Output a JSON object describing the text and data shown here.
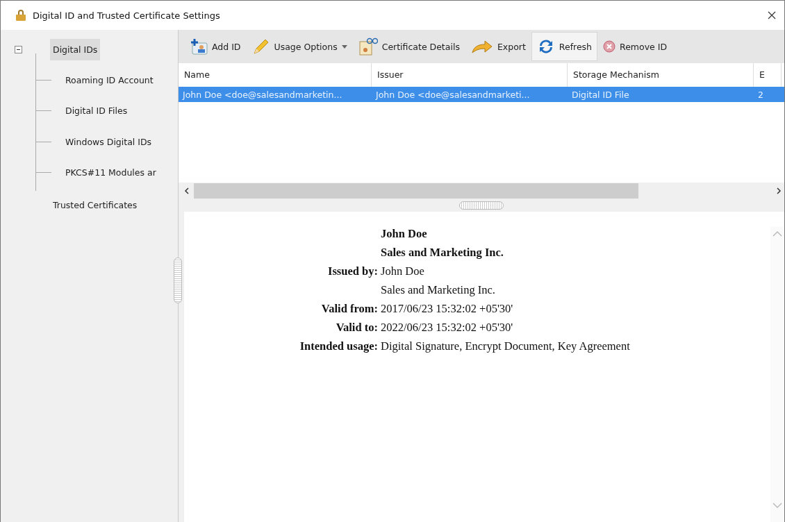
{
  "window": {
    "title": "Digital ID and Trusted Certificate Settings"
  },
  "sidebar": {
    "items": [
      {
        "label": "Digital IDs",
        "selected": true,
        "expanded": true,
        "children": [
          {
            "label": "Roaming ID Account",
            "selected": false
          },
          {
            "label": "Digital ID Files",
            "selected": false
          },
          {
            "label": "Windows Digital IDs",
            "selected": false
          },
          {
            "label": "PKCS#11 Modules ar",
            "selected": false
          }
        ]
      },
      {
        "label": "Trusted Certificates",
        "selected": false
      }
    ]
  },
  "toolbar": [
    {
      "kind": "add",
      "label": "Add ID",
      "dropdown": false,
      "hovered": false
    },
    {
      "kind": "usage",
      "label": "Usage Options",
      "dropdown": true,
      "hovered": false
    },
    {
      "kind": "details",
      "label": "Certificate Details",
      "dropdown": false,
      "hovered": false
    },
    {
      "kind": "export",
      "label": "Export",
      "dropdown": false,
      "hovered": false
    },
    {
      "kind": "refresh",
      "label": "Refresh",
      "dropdown": false,
      "hovered": true
    },
    {
      "kind": "remove",
      "label": "Remove ID",
      "dropdown": false,
      "hovered": false
    }
  ],
  "table": {
    "columns": [
      "Name",
      "Issuer",
      "Storage Mechanism",
      "E"
    ],
    "rows": [
      {
        "selected": true,
        "cells": [
          "John Doe <doe@salesandmarketin...",
          "John Doe <doe@salesandmarketi...",
          "Digital ID File",
          "2"
        ]
      }
    ]
  },
  "details": [
    {
      "kind": "heading",
      "value": "John Doe"
    },
    {
      "kind": "heading",
      "value": "Sales and Marketing Inc."
    },
    {
      "kind": "field",
      "label": "Issued by:",
      "value": "John Doe"
    },
    {
      "kind": "field",
      "value": "Sales and Marketing Inc."
    },
    {
      "kind": "field",
      "label": "Valid from:",
      "value": "2017/06/23 15:32:02 +05'30'"
    },
    {
      "kind": "field",
      "label": "Valid to:",
      "value": "2022/06/23 15:32:02 +05'30'"
    },
    {
      "kind": "field",
      "label": "Intended usage:",
      "value": "Digital Signature, Encrypt Document, Key Agreement"
    }
  ]
}
